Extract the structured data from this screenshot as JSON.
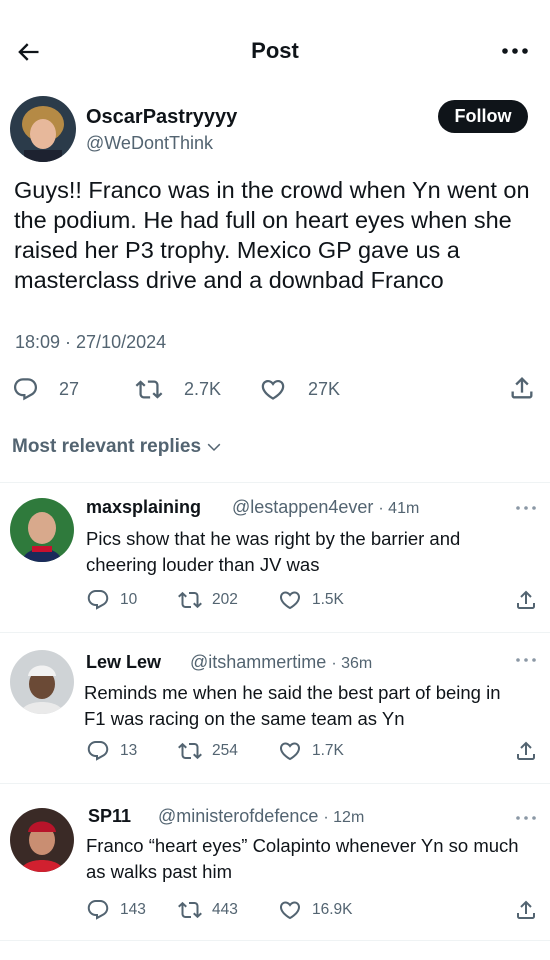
{
  "header": {
    "title": "Post"
  },
  "post": {
    "display_name": "OscarPastryyyy",
    "handle": "@WeDontThink",
    "follow_label": "Follow",
    "text": "Guys!! Franco was in the crowd when Yn went on the podium. He had full on heart eyes when she raised her P3 trophy. Mexico GP gave us a masterclass drive and a downbad Franco",
    "timestamp": "18:09 · 27/10/2024",
    "replies": "27",
    "reposts": "2.7K",
    "likes": "27K"
  },
  "replies_section": {
    "label": "Most relevant replies"
  },
  "replies": [
    {
      "display_name": "maxsplaining",
      "handle": "@lestappen4ever",
      "time": "· 41m",
      "text": "Pics show that he was right by the barrier and cheering louder than JV was",
      "replies": "10",
      "reposts": "202",
      "likes": "1.5K"
    },
    {
      "display_name": "Lew Lew",
      "handle": "@itshammertime",
      "time": "· 36m",
      "text": "Reminds me when he said the best part of being in F1 was racing on the same team as Yn",
      "replies": "13",
      "reposts": "254",
      "likes": "1.7K"
    },
    {
      "display_name": "SP11",
      "handle": "@ministerofdefence",
      "time": "· 12m",
      "text": "Franco “heart eyes” Colapinto whenever Yn so much as walks past him",
      "replies": "143",
      "reposts": "443",
      "likes": "16.9K"
    }
  ],
  "colors": {
    "text": "#0f1419",
    "secondary": "#536471",
    "divider": "#eff3f4",
    "follow_bg": "#0f1419"
  },
  "icons": [
    "back-arrow-icon",
    "more-horizontal-icon",
    "reply-icon",
    "repost-icon",
    "like-icon",
    "share-icon",
    "chevron-down-icon"
  ]
}
